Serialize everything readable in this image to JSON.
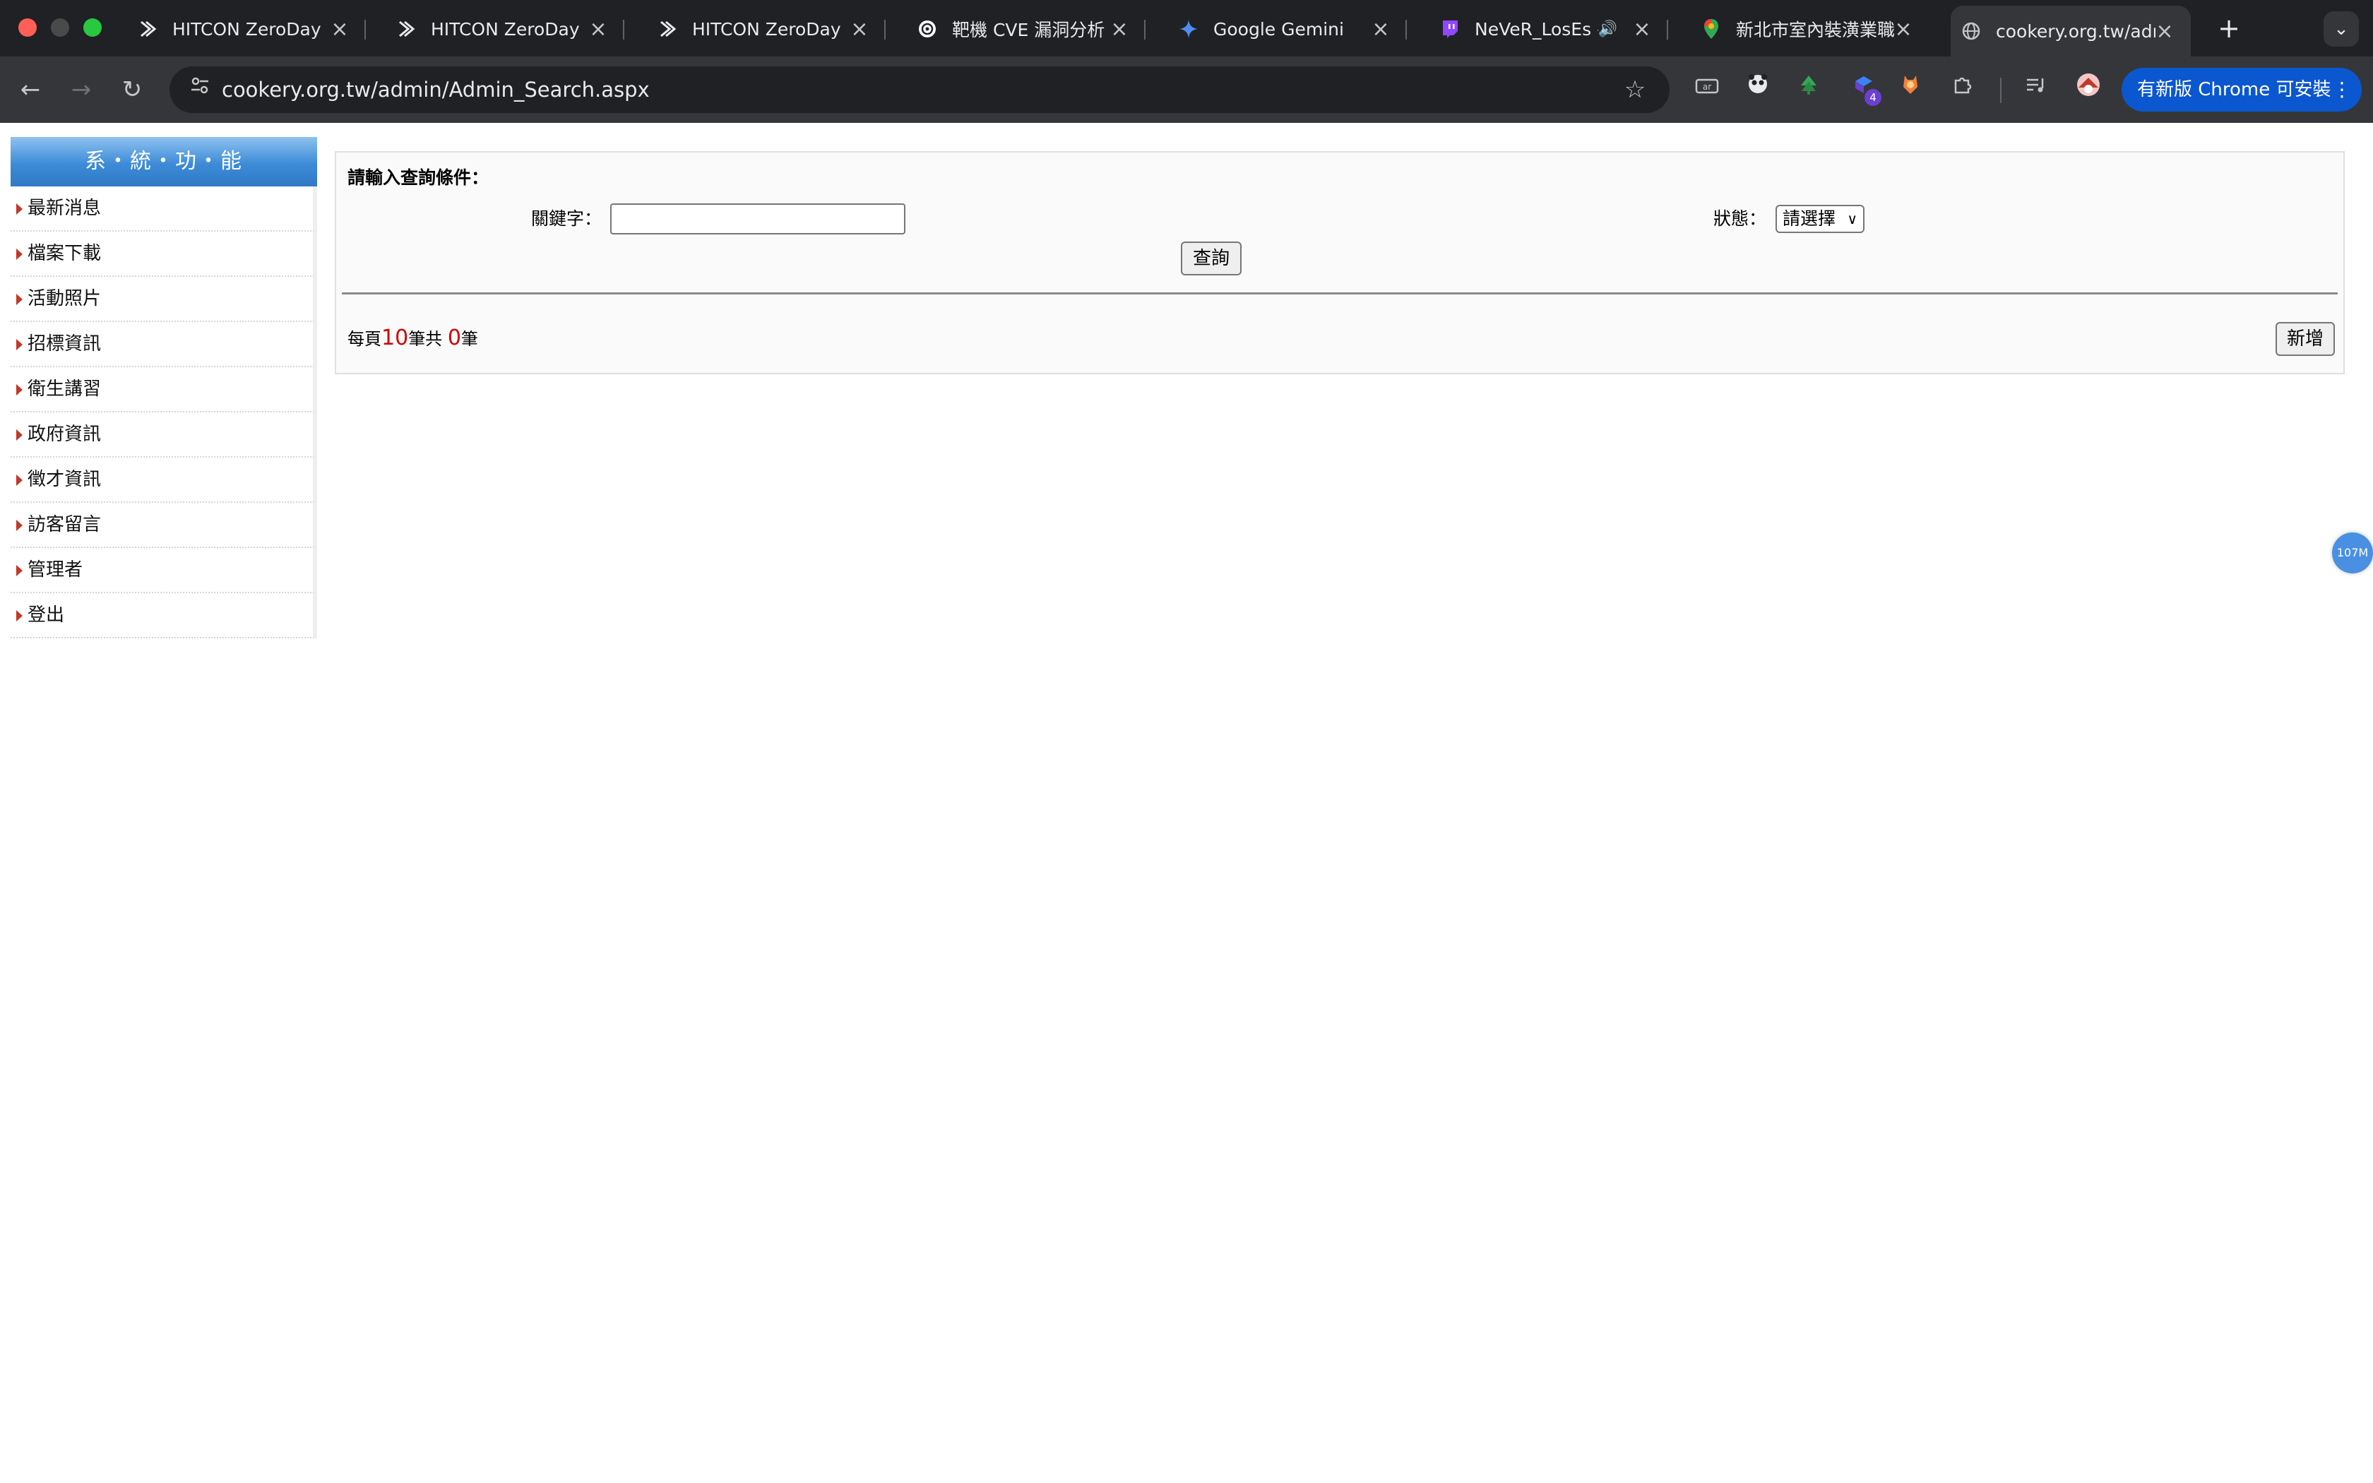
{
  "browser": {
    "tabs": [
      {
        "title": "HITCON ZeroDay",
        "icon": "hitcon-icon"
      },
      {
        "title": "HITCON ZeroDay",
        "icon": "hitcon-icon"
      },
      {
        "title": "HITCON ZeroDay",
        "icon": "hitcon-icon"
      },
      {
        "title": "靶機 CVE 漏洞分析",
        "icon": "openai-icon"
      },
      {
        "title": "Google Gemini",
        "icon": "gemini-icon"
      },
      {
        "title": "NeVeR_LosEs -",
        "icon": "twitch-icon"
      },
      {
        "title": "新北市室內裝潢業職",
        "icon": "maps-pin-icon"
      },
      {
        "title": "cookery.org.tw/adm",
        "icon": "globe-icon"
      }
    ],
    "url": "cookery.org.tw/admin/Admin_Search.aspx",
    "update_button": "有新版 Chrome 可安裝",
    "extension_badge_count": "4",
    "accent": "#0b57d0"
  },
  "sidebar": {
    "header": "系・統・功・能",
    "items": [
      {
        "label": "最新消息"
      },
      {
        "label": "檔案下載"
      },
      {
        "label": "活動照片"
      },
      {
        "label": "招標資訊"
      },
      {
        "label": "衛生講習"
      },
      {
        "label": "政府資訊"
      },
      {
        "label": "徵才資訊"
      },
      {
        "label": "訪客留言"
      },
      {
        "label": "管理者"
      },
      {
        "label": "登出"
      }
    ]
  },
  "search": {
    "title": "請輸入查詢條件：",
    "keyword_label": "關鍵字：",
    "keyword_value": "",
    "status_label": "狀態：",
    "status_selected": "請選擇",
    "query_button": "查詢"
  },
  "results": {
    "per_page_prefix": "每頁",
    "per_page": "10",
    "total_prefix": "筆共",
    "total": "0",
    "total_suffix": "筆",
    "add_button": "新增"
  },
  "floating_badge": "107M"
}
